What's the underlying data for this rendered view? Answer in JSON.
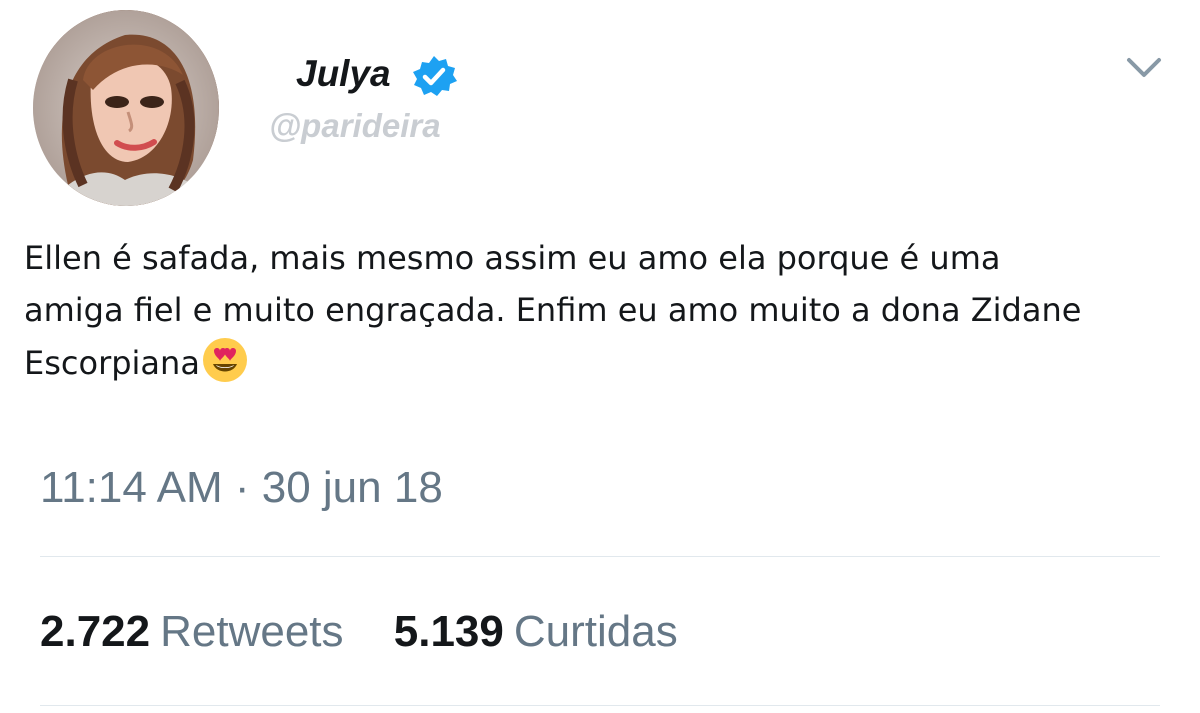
{
  "user": {
    "display_name": "Julya",
    "handle": "@parideira",
    "verified": true,
    "avatar_icon": "profile-photo"
  },
  "tweet": {
    "text_lines": [
      "Ellen é safada, mais mesmo assim eu amo ela porque é uma",
      "amiga fiel e muito engraçada. Enfim eu amo muito a dona Zidane",
      "Escorpiana"
    ],
    "emoji": "smiling-face-with-heart-eyes"
  },
  "meta": {
    "timestamp": "11:14 AM · 30 jun 18"
  },
  "stats": {
    "retweets": {
      "count": "2.722",
      "label": "Retweets"
    },
    "likes": {
      "count": "5.139",
      "label": "Curtidas"
    }
  },
  "colors": {
    "text_primary": "#14171a",
    "text_secondary": "#657786",
    "handle": "#c9cdd2",
    "verified_badge": "#1da1f2",
    "divider": "#e1e8ed"
  },
  "icons": {
    "verified": "verified-badge-icon",
    "more": "chevron-down-icon",
    "emoji": "heart-eyes-emoji-icon"
  }
}
